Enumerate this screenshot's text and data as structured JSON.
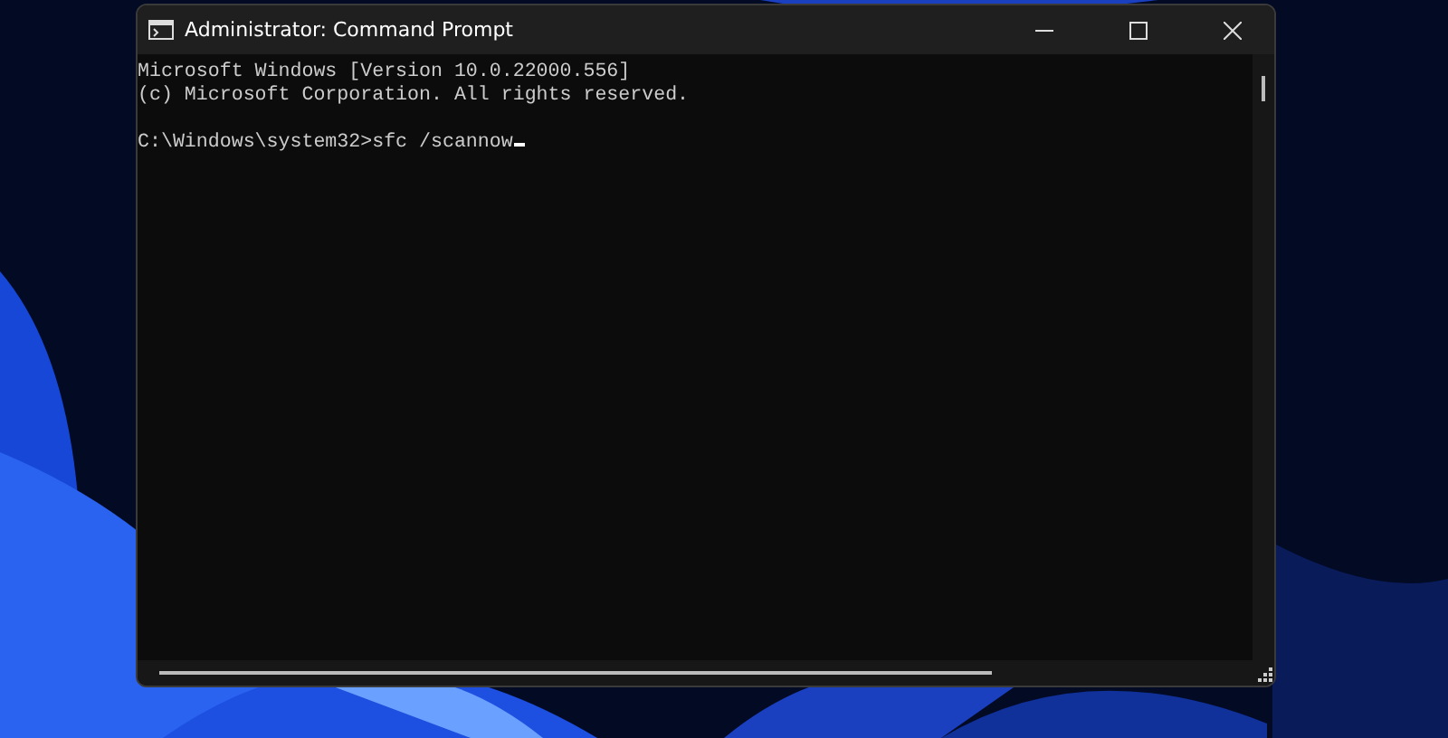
{
  "window": {
    "title": "Administrator: Command Prompt"
  },
  "console": {
    "blocks": [
      [
        "Microsoft Windows [Version 10.0.22000.556]",
        "(c) Microsoft Corporation. All rights reserved."
      ],
      [
        "C:\\Windows\\system32>sfc /scannow"
      ]
    ],
    "cursor": true
  }
}
